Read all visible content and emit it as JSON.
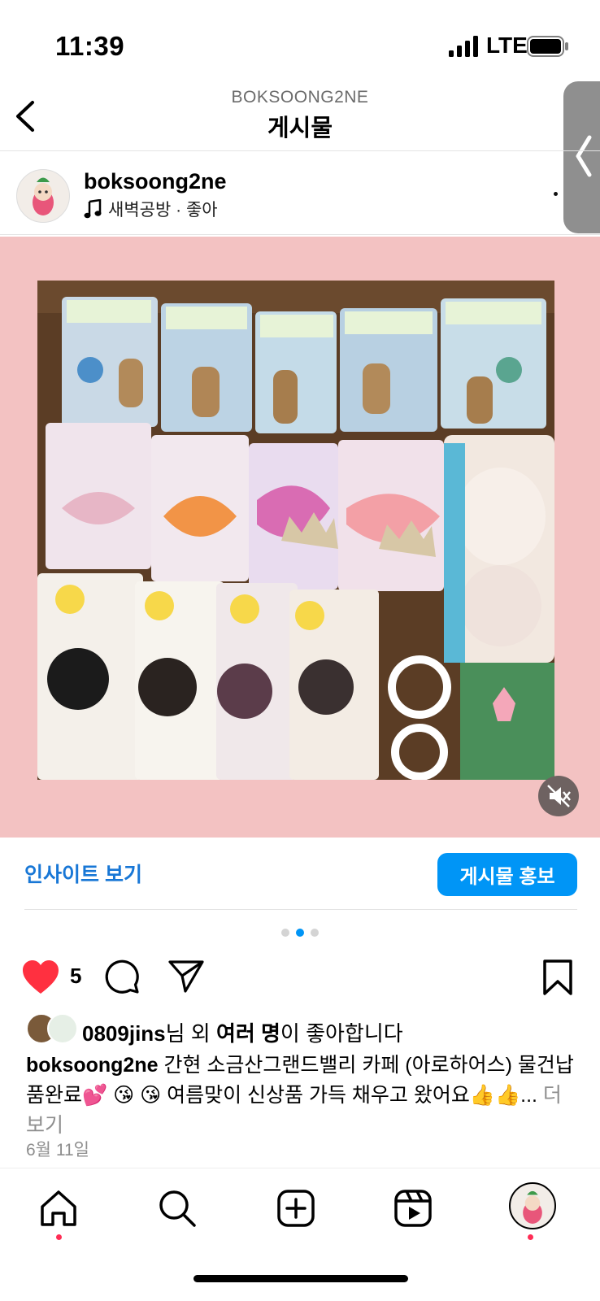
{
  "status_bar": {
    "time": "11:39",
    "network": "LTE"
  },
  "header": {
    "account": "BOKSOONG2NE",
    "title": "게시물"
  },
  "post": {
    "username": "boksoong2ne",
    "music": "새벽공방 · 좋아",
    "carousel": {
      "total": 3,
      "active_index": 1
    },
    "likes_count": "5",
    "liked_by": {
      "name": "0809jins",
      "suffix1": "님 외 ",
      "others": "여러 명",
      "suffix2": "이 좋아합니다"
    },
    "caption": {
      "author": "boksoong2ne",
      "text": " 간현 소금산그랜드밸리 카페 (아로하어스) 물건납품완료💕 😘 😘 여름맞이 신상품 가득 채우고 왔어요👍👍",
      "ellipsis": "...",
      "more": " 더 보기"
    },
    "date": "6월 11일"
  },
  "actions": {
    "insights": "인사이트 보기",
    "promote": "게시물 홍보"
  },
  "colors": {
    "accent": "#0095f6",
    "like": "#ff3040",
    "media_bg": "#f3c2c2",
    "notification_dot": "#ff2d55"
  },
  "icons": [
    "back-icon",
    "music-icon",
    "more-icon",
    "mute-icon",
    "heart-icon",
    "comment-icon",
    "share-icon",
    "bookmark-icon",
    "home-icon",
    "search-icon",
    "create-icon",
    "reels-icon",
    "profile-icon"
  ]
}
